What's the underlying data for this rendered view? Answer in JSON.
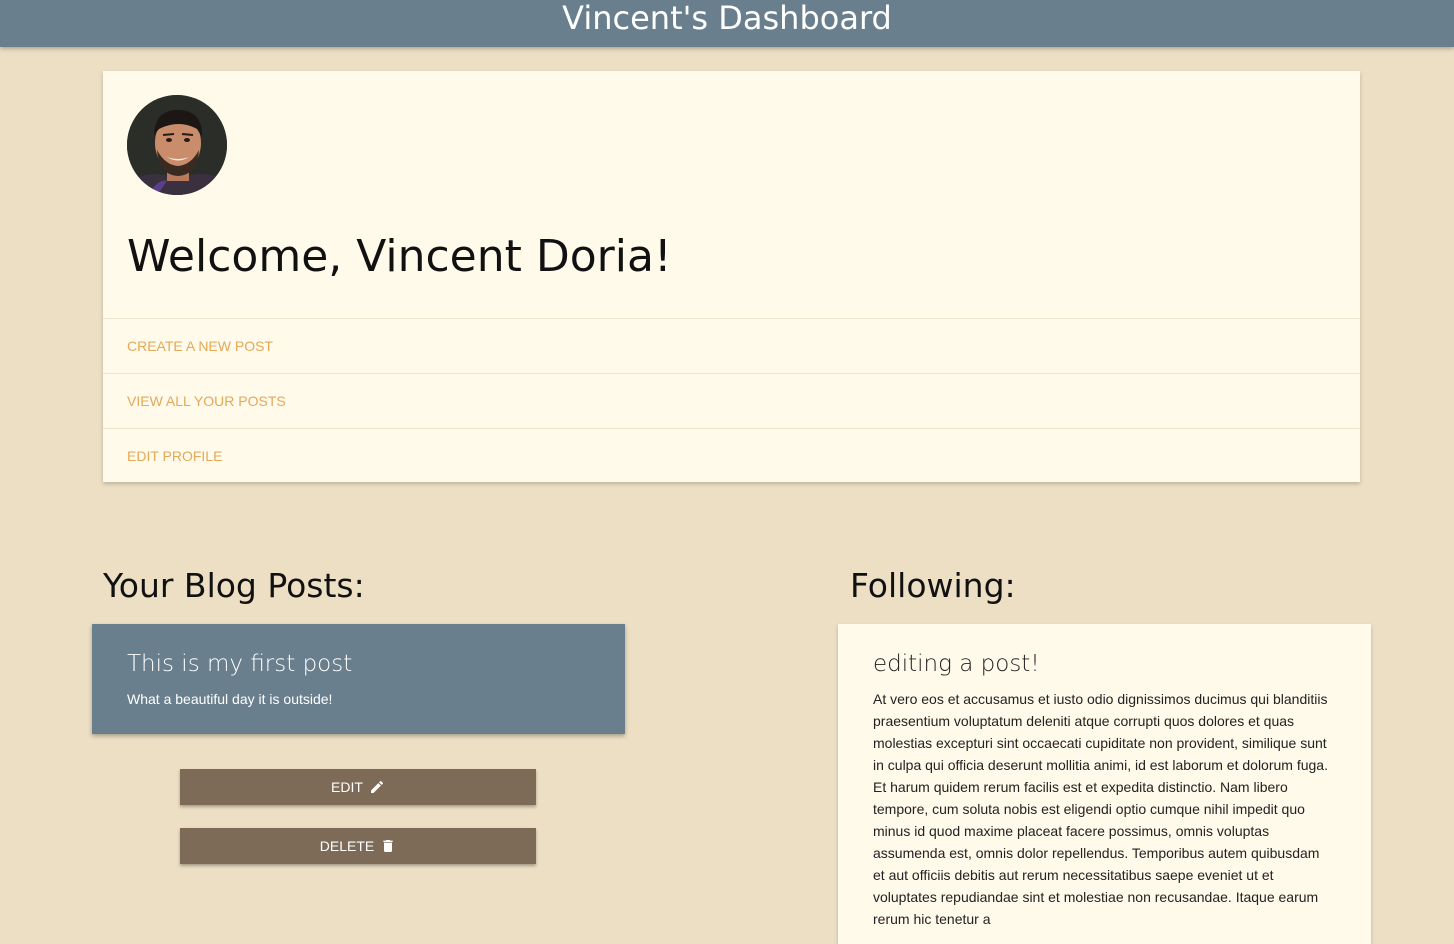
{
  "header": {
    "title": "Vincent's Dashboard"
  },
  "profile": {
    "welcome": "Welcome, Vincent Doria!",
    "links": [
      {
        "label": "CREATE A NEW POST"
      },
      {
        "label": "VIEW ALL YOUR POSTS"
      },
      {
        "label": "EDIT PROFILE"
      }
    ]
  },
  "blog": {
    "heading": "Your Blog Posts:",
    "post": {
      "title": "This is my first post",
      "excerpt": "What a beautiful day it is outside!"
    },
    "edit_label": "EDIT",
    "delete_label": "DELETE"
  },
  "following": {
    "heading": "Following:",
    "post": {
      "title": "editing a post!",
      "body": "At vero eos et accusamus et iusto odio dignissimos ducimus qui blanditiis praesentium voluptatum deleniti atque corrupti quos dolores et quas molestias excepturi sint occaecati cupiditate non provident, similique sunt in culpa qui officia deserunt mollitia animi, id est laborum et dolorum fuga. Et harum quidem rerum facilis est et expedita distinctio. Nam libero tempore, cum soluta nobis est eligendi optio cumque nihil impedit quo minus id quod maxime placeat facere possimus, omnis voluptas assumenda est, omnis dolor repellendus. Temporibus autem quibusdam et aut officiis debitis aut rerum necessitatibus saepe eveniet ut et voluptates repudiandae sint et molestiae non recusandae. Itaque earum rerum hic tenetur a"
    }
  },
  "icons": {
    "edit": "pencil-icon",
    "delete": "trash-icon"
  },
  "colors": {
    "page_bg": "#ecdfc4",
    "header_bg": "#6a7f8e",
    "card_bg": "#fffaea",
    "link": "#e4a85a",
    "button_bg": "#7d6b58"
  }
}
